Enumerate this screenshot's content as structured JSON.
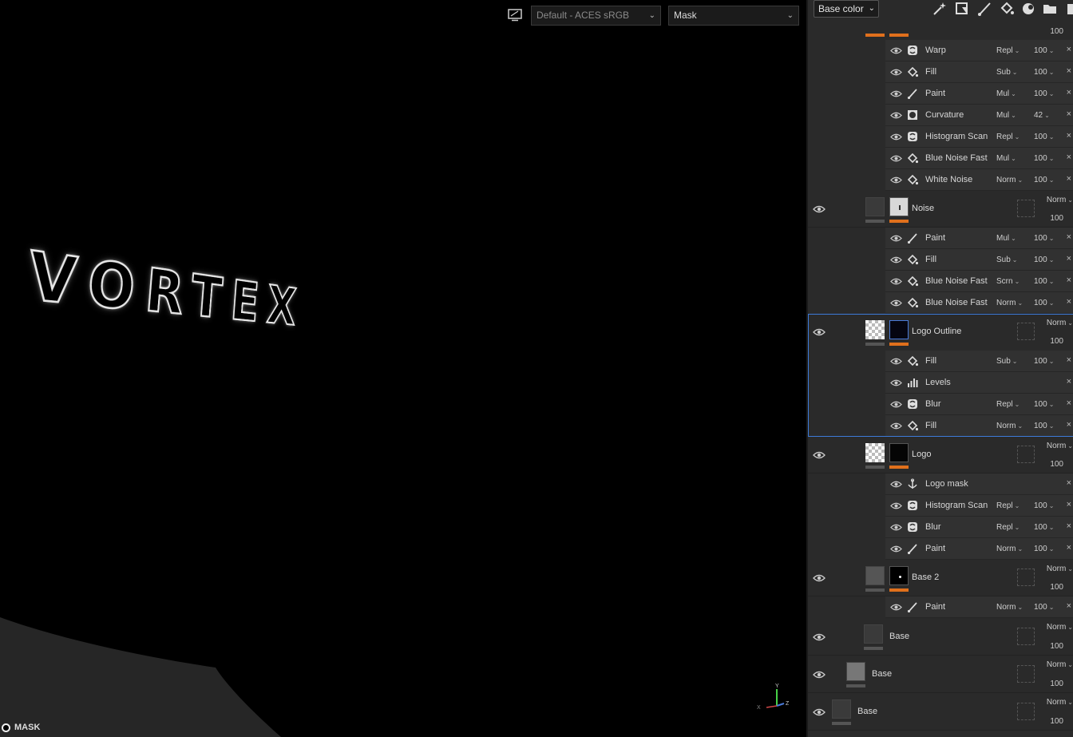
{
  "viewport": {
    "logo_text": "VORTEX",
    "colorspace": "Default - ACES sRGB",
    "display_mode": "Mask",
    "mask_label": "MASK",
    "axes": {
      "x": "X",
      "y": "Y",
      "z": "Z"
    }
  },
  "panel": {
    "channel": "Base color",
    "top_opacity": "100",
    "groups": [
      {
        "layer": null,
        "effects": [
          {
            "name": "Warp",
            "icon": "filter-icon",
            "blend": "Repl",
            "opacity": "100"
          },
          {
            "name": "Fill",
            "icon": "fill-bucket-icon",
            "blend": "Sub",
            "opacity": "100"
          },
          {
            "name": "Paint",
            "icon": "brush-icon",
            "blend": "Mul",
            "opacity": "100"
          },
          {
            "name": "Curvature",
            "icon": "generator-icon",
            "blend": "Mul",
            "opacity": "42"
          },
          {
            "name": "Histogram Scan",
            "icon": "filter-icon",
            "blend": "Repl",
            "opacity": "100"
          },
          {
            "name": "Blue Noise Fast",
            "icon": "fill-bucket-icon",
            "blend": "Mul",
            "opacity": "100"
          },
          {
            "name": "White Noise",
            "icon": "fill-bucket-icon",
            "blend": "Norm",
            "opacity": "100"
          }
        ]
      },
      {
        "layer": {
          "name": "Noise",
          "blend": "Norm",
          "opacity": "100"
        },
        "effects": [
          {
            "name": "Paint",
            "icon": "brush-icon",
            "blend": "Mul",
            "opacity": "100"
          },
          {
            "name": "Fill",
            "icon": "fill-bucket-icon",
            "blend": "Sub",
            "opacity": "100"
          },
          {
            "name": "Blue Noise Fast",
            "icon": "fill-bucket-icon",
            "blend": "Scrn",
            "opacity": "100"
          },
          {
            "name": "Blue Noise Fast",
            "icon": "fill-bucket-icon",
            "blend": "Norm",
            "opacity": "100"
          }
        ]
      },
      {
        "layer": {
          "name": "Logo Outline",
          "blend": "Norm",
          "opacity": "100",
          "selected": true
        },
        "effects": [
          {
            "name": "Fill",
            "icon": "fill-bucket-icon",
            "blend": "Sub",
            "opacity": "100"
          },
          {
            "name": "Levels",
            "icon": "levels-icon",
            "blend": "",
            "opacity": ""
          },
          {
            "name": "Blur",
            "icon": "filter-icon",
            "blend": "Repl",
            "opacity": "100"
          },
          {
            "name": "Fill",
            "icon": "fill-bucket-icon",
            "blend": "Norm",
            "opacity": "100"
          }
        ]
      },
      {
        "layer": {
          "name": "Logo",
          "blend": "Norm",
          "opacity": "100"
        },
        "effects": [
          {
            "name": "Logo mask",
            "icon": "anchor-icon",
            "blend": "",
            "opacity": ""
          },
          {
            "name": "Histogram Scan",
            "icon": "filter-icon",
            "blend": "Repl",
            "opacity": "100"
          },
          {
            "name": "Blur",
            "icon": "filter-icon",
            "blend": "Repl",
            "opacity": "100"
          },
          {
            "name": "Paint",
            "icon": "brush-icon",
            "blend": "Norm",
            "opacity": "100"
          }
        ]
      },
      {
        "layer": {
          "name": "Base 2",
          "blend": "Norm",
          "opacity": "100"
        },
        "effects": [
          {
            "name": "Paint",
            "icon": "brush-icon",
            "blend": "Norm",
            "opacity": "100"
          }
        ]
      },
      {
        "layer": {
          "name": "Base",
          "blend": "Norm",
          "opacity": "100"
        },
        "effects": []
      },
      {
        "layer": {
          "name": "Base",
          "blend": "Norm",
          "opacity": "100"
        },
        "effects": []
      },
      {
        "layer": {
          "name": "Base",
          "blend": "Norm",
          "opacity": "100"
        },
        "effects": []
      }
    ],
    "colors": {
      "accent": "#e0701c",
      "selection": "#3d7ad8"
    }
  }
}
